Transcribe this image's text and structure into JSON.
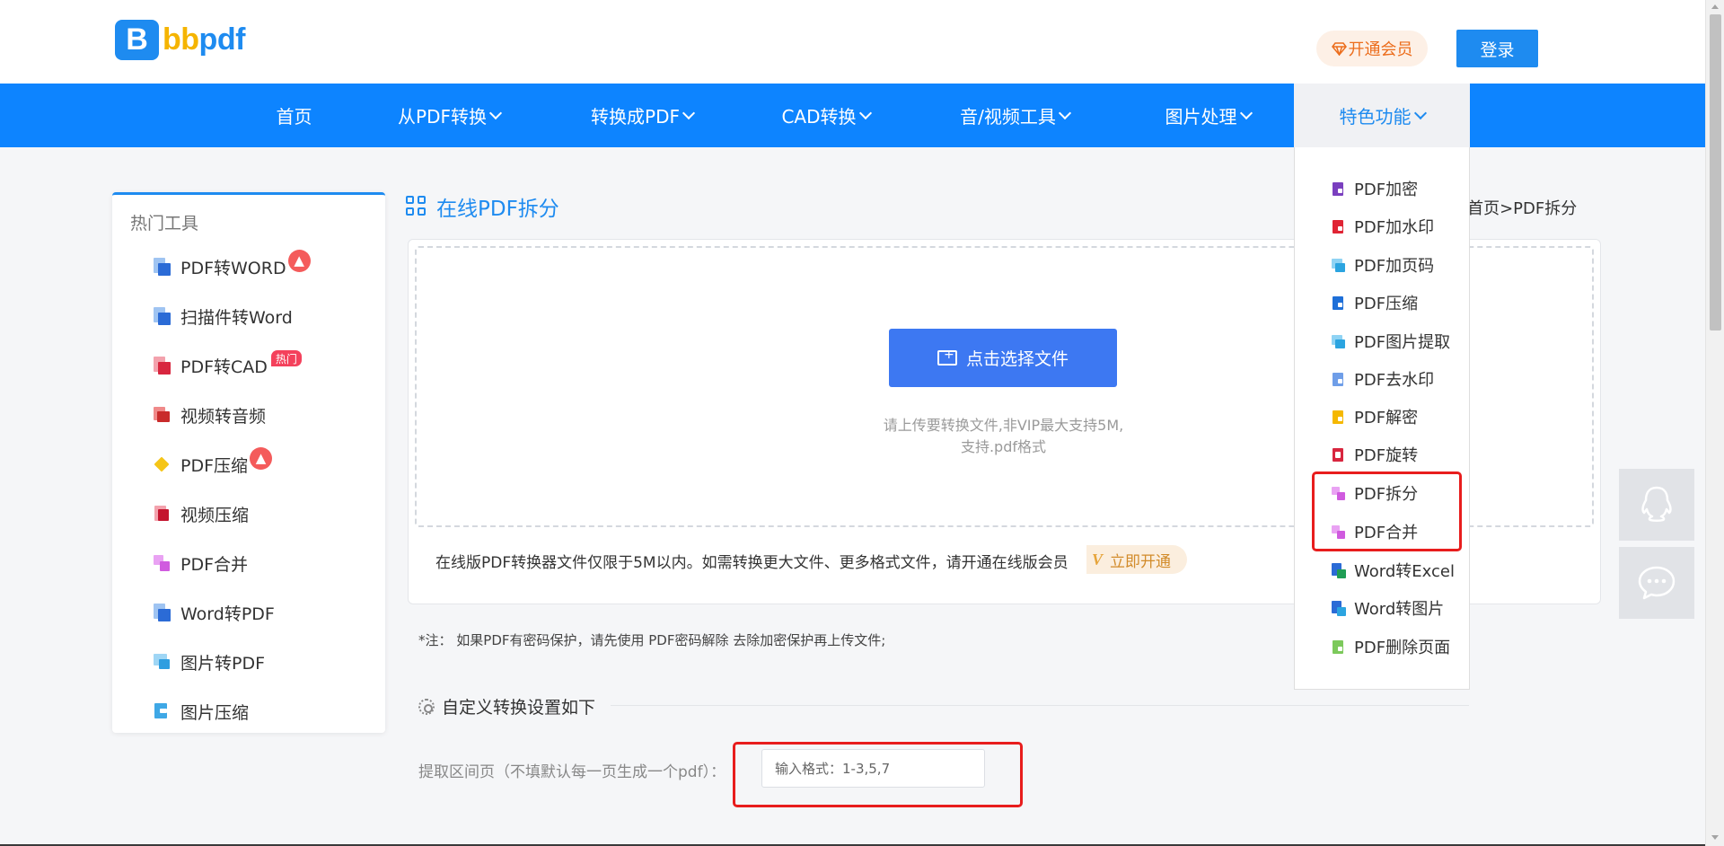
{
  "header": {
    "logo_letter": "B",
    "logo_text_1": "bb",
    "logo_text_2": "pdf",
    "vip_label": "开通会员",
    "login_label": "登录"
  },
  "nav": {
    "items": [
      {
        "label": "首页"
      },
      {
        "label": "从PDF转换"
      },
      {
        "label": "转换成PDF"
      },
      {
        "label": "CAD转换"
      },
      {
        "label": "音/视频工具"
      },
      {
        "label": "图片处理"
      },
      {
        "label": "特色功能"
      }
    ],
    "active_index": 6
  },
  "sidebar": {
    "title": "热门工具",
    "items": [
      {
        "label": "PDF转WORD",
        "badge": "fire"
      },
      {
        "label": "扫描件转Word"
      },
      {
        "label": "PDF转CAD",
        "badge": "热门"
      },
      {
        "label": "视频转音频"
      },
      {
        "label": "PDF压缩",
        "badge": "fire"
      },
      {
        "label": "视频压缩"
      },
      {
        "label": "PDF合并"
      },
      {
        "label": "Word转PDF"
      },
      {
        "label": "图片转PDF"
      },
      {
        "label": "图片压缩"
      }
    ]
  },
  "main": {
    "title": "在线PDF拆分",
    "breadcrumb": "置:首页>PDF拆分",
    "choose_button": "点击选择文件",
    "upload_hint_1": "请上传要转换文件,非VIP最大支持5M,",
    "upload_hint_2": "支持.pdf格式",
    "limit_text": "在线版PDF转换器文件仅限于5M以内。如需转换更大文件、更多格式文件，请开通在线版会员",
    "open_now": "立即开通",
    "note": "*注： 如果PDF有密码保护，请先使用 PDF密码解除 去除加密保护再上传文件;",
    "settings_title": "自定义转换设置如下",
    "range_label": "提取区间页（不填默认每一页生成一个pdf）：",
    "range_placeholder": "输入格式：1-3,5,7"
  },
  "dropdown": {
    "items": [
      {
        "label": "PDF加密"
      },
      {
        "label": "PDF加水印"
      },
      {
        "label": "PDF加页码"
      },
      {
        "label": "PDF压缩"
      },
      {
        "label": "PDF图片提取"
      },
      {
        "label": "PDF去水印"
      },
      {
        "label": "PDF解密"
      },
      {
        "label": "PDF旋转"
      },
      {
        "label": "PDF拆分"
      },
      {
        "label": "PDF合并"
      },
      {
        "label": "Word转Excel"
      },
      {
        "label": "Word转图片"
      },
      {
        "label": "PDF删除页面"
      }
    ]
  },
  "floats": [
    "qq-icon",
    "chat-icon"
  ],
  "colors": {
    "brand_blue": "#0d84ff",
    "button_blue": "#3d78f2",
    "highlight_red": "#e81d1d",
    "vip_orange": "#ec6d1c"
  }
}
